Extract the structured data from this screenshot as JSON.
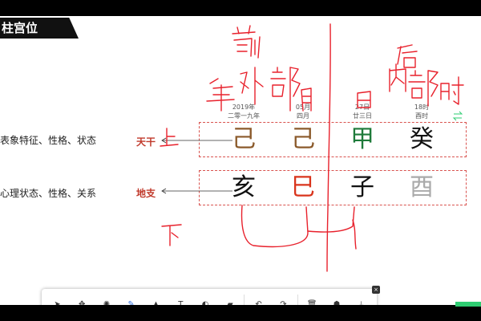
{
  "title": "柱宫位",
  "rows": [
    {
      "desc": "表象特征、性格、状态",
      "tag": "天干"
    },
    {
      "desc": "心理状态、性格、关系",
      "tag": "地支"
    }
  ],
  "columns": [
    {
      "head1": "2019年",
      "head2": "二零一九年",
      "stem": "己",
      "branch": "亥",
      "stem_color": "#8b5a2b",
      "branch_color": "#111111"
    },
    {
      "head1": "05月",
      "head2": "四月",
      "stem": "己",
      "branch": "巳",
      "stem_color": "#8b5a2b",
      "branch_color": "#d9341c"
    },
    {
      "head1": "27日",
      "head2": "廿三日",
      "stem": "甲",
      "branch": "子",
      "stem_color": "#1e7a3a",
      "branch_color": "#111111"
    },
    {
      "head1": "18时",
      "head2": "酉时",
      "stem": "癸",
      "branch": "酉",
      "stem_color": "#111111",
      "branch_color": "#aaaaaa"
    }
  ],
  "toolbar": {
    "items": [
      {
        "label": "鼠标",
        "icon": "pointer-icon"
      },
      {
        "label": "选择",
        "icon": "move-icon"
      },
      {
        "label": "激光笔",
        "icon": "laser-icon"
      },
      {
        "label": "画笔",
        "icon": "pen-icon"
      },
      {
        "label": "荧光笔",
        "icon": "highlighter-icon"
      },
      {
        "label": "文本",
        "icon": "text-icon"
      },
      {
        "label": "图形",
        "icon": "shape-icon"
      },
      {
        "label": "橡皮擦",
        "icon": "eraser-icon"
      },
      {
        "label": "撤销",
        "icon": "undo-icon"
      },
      {
        "label": "恢复",
        "icon": "redo-icon"
      },
      {
        "label": "清空",
        "icon": "trash-icon"
      },
      {
        "label": "批注设置",
        "icon": "settings-icon"
      },
      {
        "label": "保存",
        "icon": "save-icon"
      }
    ],
    "active_index": 3
  },
  "colors": {
    "accent": "#2f6fe0",
    "ink_red": "#e8212c",
    "tag_red": "#c0392b"
  }
}
